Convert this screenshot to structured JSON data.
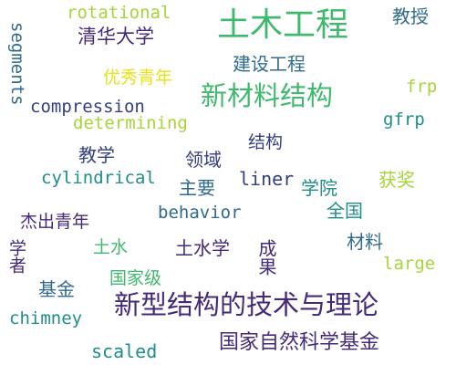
{
  "words": {
    "w01": "土木工程",
    "w02": "新型结构的技术与理论",
    "w03": "新材料结构",
    "w04": "国家自然科学基金",
    "w05": "清华大学",
    "w06": "优秀青年",
    "w07": "建设工程",
    "w08": "教授",
    "w09": "rotational",
    "w10": "segments",
    "w11": "compression",
    "w12": "determining",
    "w13": "frp",
    "w14": "gfrp",
    "w15": "cylindrical",
    "w16": "liner",
    "w17": "behavior",
    "w18": "chimney",
    "w19": "scaled",
    "w20": "large",
    "w21": "教学",
    "w22": "领域",
    "w23": "结构",
    "w24": "主要",
    "w25": "学院",
    "w26": "获奖",
    "w27": "全国",
    "w28": "杰出青年",
    "w29": "学者",
    "w30": "土水",
    "w31": "土水学",
    "w32": "成果",
    "w33": "材料",
    "w34": "基金",
    "w35": "国家级"
  },
  "colors": {
    "dark_purple": "#452a7a",
    "navy": "#34407e",
    "blue_teal": "#2f6b8e",
    "teal": "#1f8d8a",
    "green": "#3fb96e",
    "yellow_green": "#a6d53b",
    "yellow": "#e4e419"
  }
}
